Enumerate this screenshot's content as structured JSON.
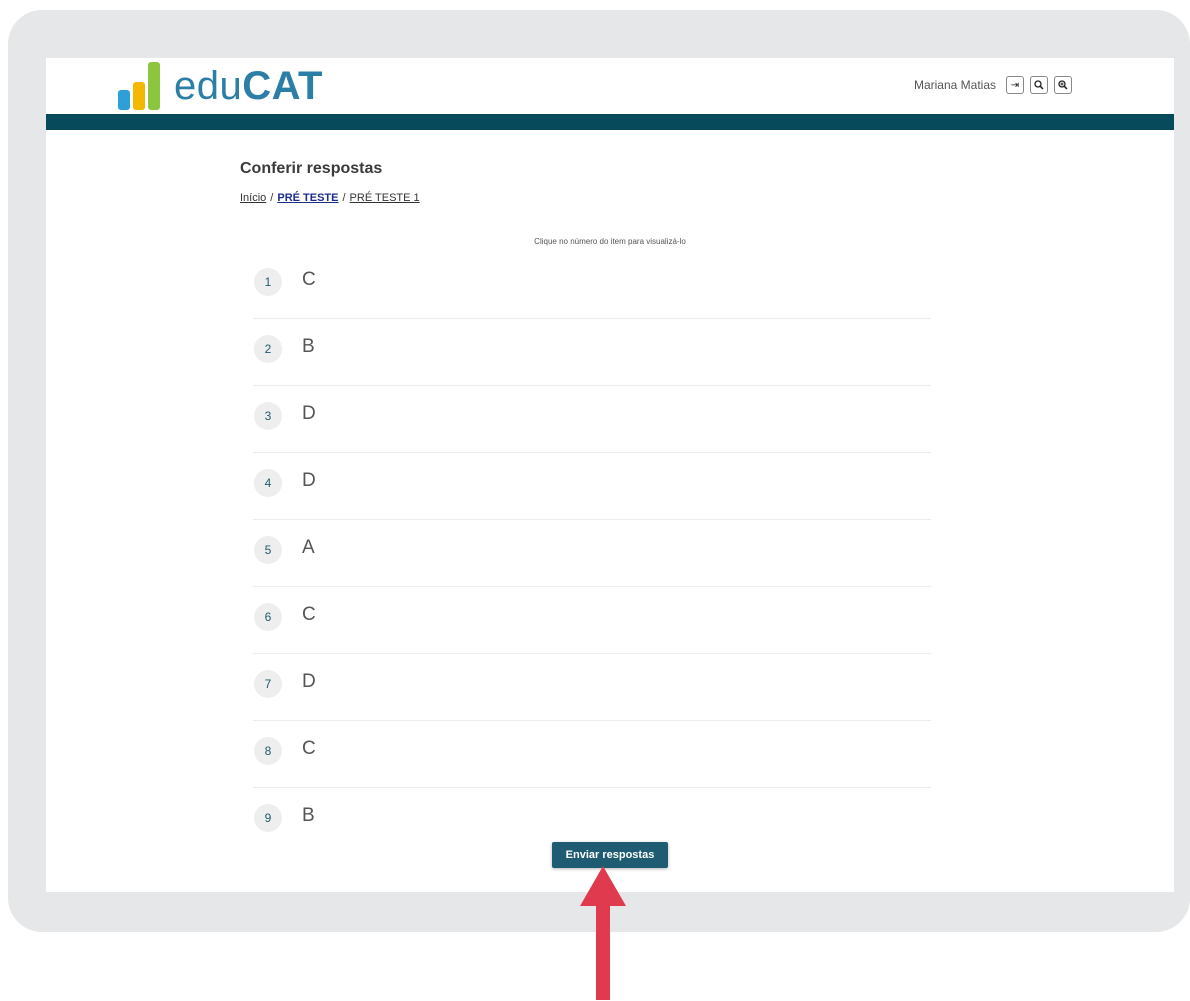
{
  "brand": {
    "light": "edu",
    "bold": "CAT"
  },
  "user": {
    "name": "Mariana Matias"
  },
  "toolbar": {
    "logout_glyph": "⇥",
    "zoom_out_glyph": "🔍",
    "zoom_in_glyph": "⊕"
  },
  "page": {
    "title": "Conferir respostas",
    "hint": "Clique no número do item para visualizá-lo"
  },
  "breadcrumb": [
    "Início",
    "PRÉ TESTE",
    "PRÉ TESTE 1"
  ],
  "answers": [
    {
      "num": "1",
      "letter": "C"
    },
    {
      "num": "2",
      "letter": "B"
    },
    {
      "num": "3",
      "letter": "D"
    },
    {
      "num": "4",
      "letter": "D"
    },
    {
      "num": "5",
      "letter": "A"
    },
    {
      "num": "6",
      "letter": "C"
    },
    {
      "num": "7",
      "letter": "D"
    },
    {
      "num": "8",
      "letter": "C"
    },
    {
      "num": "9",
      "letter": "B"
    }
  ],
  "submit_label": "Enviar respostas",
  "colors": {
    "header_band": "#074a5c",
    "button": "#1f5c71",
    "arrow": "#e03a4e",
    "brand_text": "#2b7ea6"
  }
}
